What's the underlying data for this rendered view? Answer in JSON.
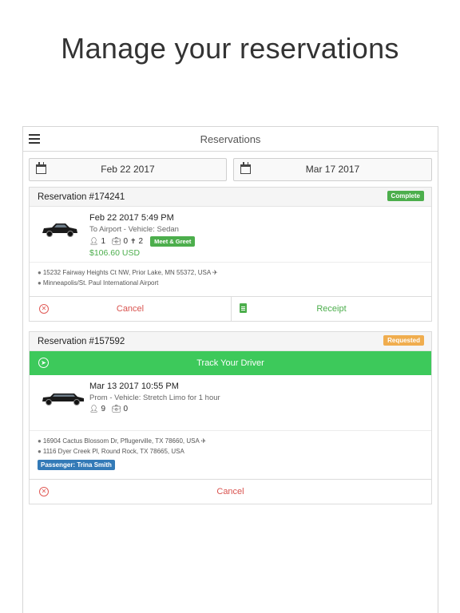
{
  "headline": "Manage your reservations",
  "navbar": {
    "title": "Reservations"
  },
  "date_range": {
    "start": "Feb 22 2017",
    "end": "Mar 17 2017"
  },
  "reservations": [
    {
      "title": "Reservation #174241",
      "status": "Complete",
      "datetime": "Feb 22 2017 5:49 PM",
      "description": "To Airport - Vehicle: Sedan",
      "passengers": "1",
      "luggage": "0",
      "child_seats": "2",
      "badge": "Meet & Greet",
      "price": "$106.60 USD",
      "pickup": "15232 Fairway Heights Ct NW, Prior Lake, MN 55372, USA",
      "dropoff": "Minneapolis/St. Paul International Airport",
      "cancel_label": "Cancel",
      "receipt_label": "Receipt"
    },
    {
      "title": "Reservation #157592",
      "status": "Requested",
      "track_label": "Track Your Driver",
      "datetime": "Mar 13 2017 10:55 PM",
      "description": "Prom - Vehicle: Stretch Limo for 1 hour",
      "passengers": "9",
      "luggage": "0",
      "pickup": "16904 Cactus Blossom Dr, Pflugerville, TX 78660, USA",
      "dropoff": "1116 Dyer Creek Pl, Round Rock, TX 78665, USA",
      "passenger_tag": "Passenger: Trina Smith",
      "cancel_label": "Cancel"
    }
  ],
  "colors": {
    "success": "#4cae4c",
    "warning": "#f0ad4e",
    "danger": "#d9534f",
    "track": "#3dc95b",
    "info": "#337ab7"
  }
}
